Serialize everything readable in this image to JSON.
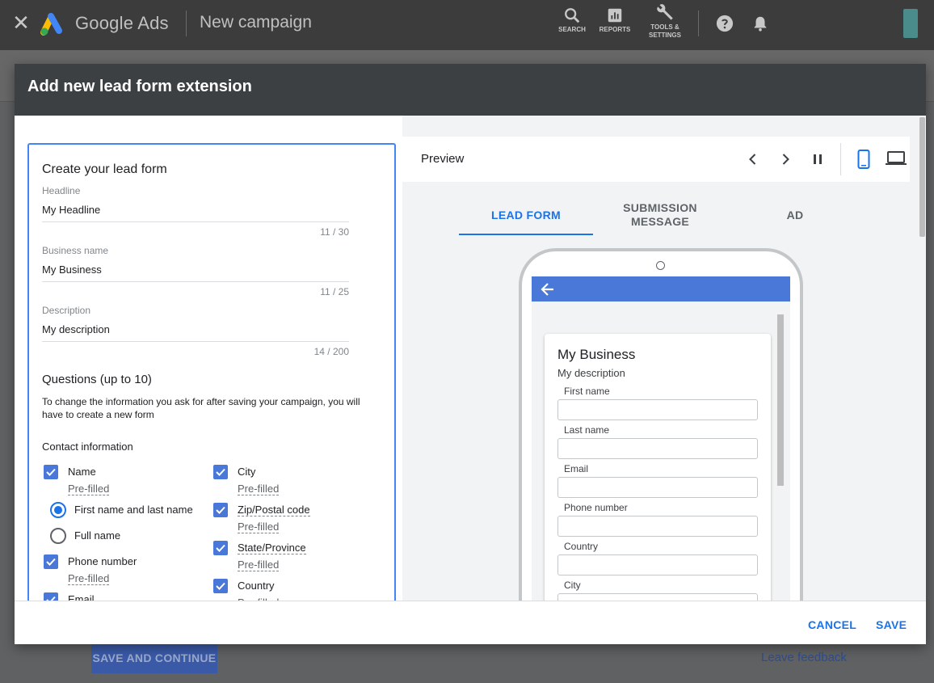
{
  "topbar": {
    "brand": "Google Ads",
    "campaign": "New campaign",
    "tools": [
      {
        "label": "SEARCH",
        "icon": "search-icon"
      },
      {
        "label": "REPORTS",
        "icon": "reports-icon"
      },
      {
        "label_line1": "TOOLS &",
        "label_line2": "SETTINGS",
        "icon": "wrench-icon"
      }
    ]
  },
  "underlay": {
    "save_continue": "SAVE AND CONTINUE",
    "feedback": "Leave feedback"
  },
  "dialog": {
    "title": "Add new lead form extension",
    "cancel": "CANCEL",
    "save": "SAVE"
  },
  "form": {
    "title": "Create your lead form",
    "headline": {
      "label": "Headline",
      "value": "My Headline",
      "count": "11 / 30"
    },
    "business": {
      "label": "Business name",
      "value": "My Business",
      "count": "11 / 25"
    },
    "description": {
      "label": "Description",
      "value": "My description",
      "count": "14 / 200"
    },
    "questions_title": "Questions (up to 10)",
    "questions_desc": "To change the information you ask for after saving your campaign, you will have to create a new form",
    "contact_title": "Contact information",
    "prefilled": "Pre-filled",
    "left_items": [
      "Name",
      "Phone number",
      "Email"
    ],
    "name_options": [
      "First name and last name",
      "Full name"
    ],
    "right_items": [
      "City",
      "Zip/Postal code",
      "State/Province",
      "Country"
    ]
  },
  "preview": {
    "title": "Preview",
    "tabs": [
      "LEAD FORM",
      "SUBMISSION MESSAGE",
      "AD"
    ],
    "business": "My Business",
    "description": "My description",
    "fields": [
      "First name",
      "Last name",
      "Email",
      "Phone number",
      "Country",
      "City"
    ]
  },
  "colors": {
    "accent": "#1a73e8",
    "checkbox": "#4a78d8",
    "header": "#3c4043",
    "topbar": "#3c3c3c"
  }
}
